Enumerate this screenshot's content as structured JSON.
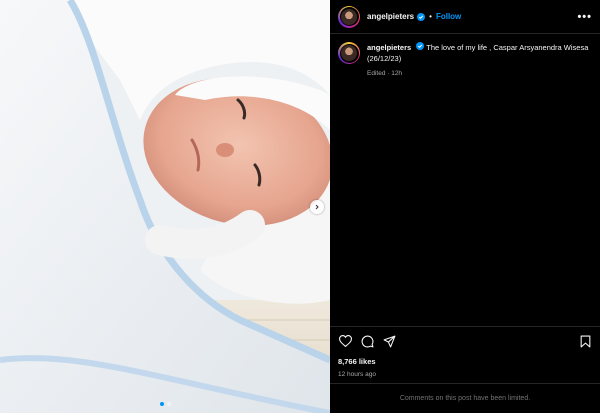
{
  "post": {
    "username": "angelpieters",
    "follow_label": "Follow",
    "separator": "•",
    "more_label": "•••",
    "caption": "The love of my life , Caspar Arsyanendra Wisesa (26/12/23)",
    "edited": "Edited · 12h",
    "likes": "8,766 likes",
    "time": "12 hours ago",
    "comments_limited": "Comments on this post have been limited.",
    "carousel": {
      "slides": 2,
      "active_index": 0
    }
  },
  "icons": {
    "verified": "verified-badge-icon",
    "like": "heart-icon",
    "comment": "comment-icon",
    "share": "send-icon",
    "save": "bookmark-icon",
    "next": "chevron-right-icon"
  },
  "colors": {
    "accent": "#0095f6",
    "background": "#000000",
    "muted": "#a8a8a8"
  }
}
